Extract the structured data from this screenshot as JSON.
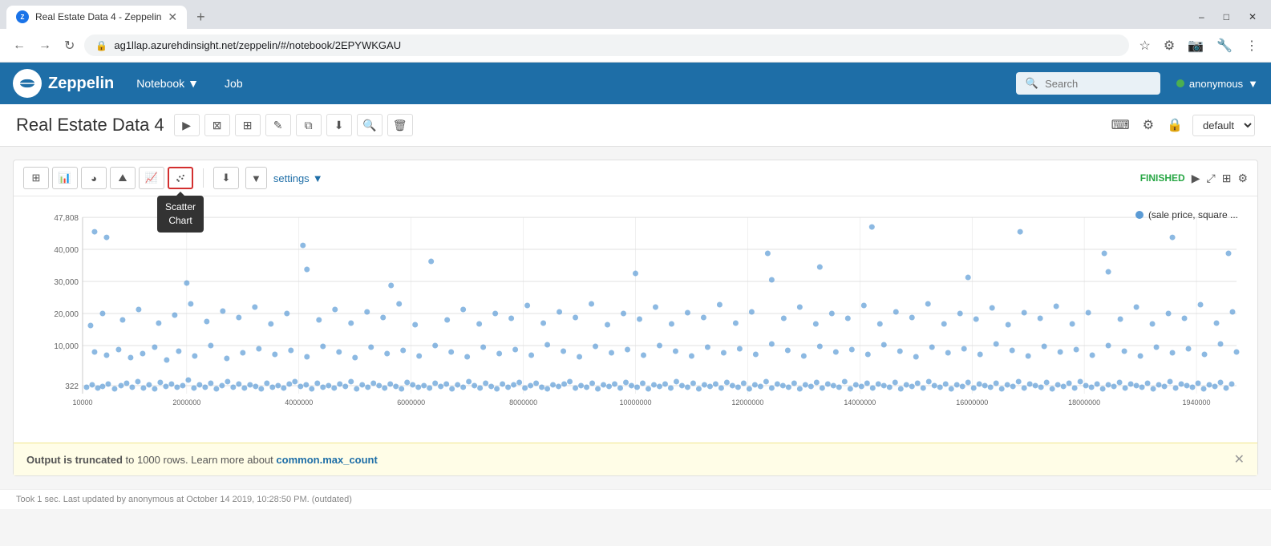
{
  "browser": {
    "tab_title": "Real Estate Data 4 - Zeppelin",
    "url": "ag1llap.azurehdinsight.net/zeppelin/#/notebook/2EPYWKGAU",
    "new_tab_icon": "+",
    "nav_back": "←",
    "nav_forward": "→",
    "nav_refresh": "↻"
  },
  "win_controls": {
    "minimize": "–",
    "maximize": "□",
    "close": "✕"
  },
  "navbar": {
    "logo_text": "Zeppelin",
    "notebook_label": "Notebook",
    "job_label": "Job",
    "search_placeholder": "Search",
    "user_name": "anonymous"
  },
  "page": {
    "title": "Real Estate Data 4",
    "default_label": "default"
  },
  "cell": {
    "status": "FINISHED",
    "settings_label": "settings",
    "legend_label": "(sale price, square ...",
    "tooltip_line1": "Scatter",
    "tooltip_line2": "Chart"
  },
  "chart": {
    "y_labels": [
      "47,808",
      "40,000",
      "30,000",
      "20,000",
      "10,000",
      "322"
    ],
    "x_labels": [
      "10000",
      "2000000",
      "4000000",
      "6000000",
      "8000000",
      "10000000",
      "12000000",
      "14000000",
      "16000000",
      "18000000",
      "1940000"
    ]
  },
  "status_bar": {
    "text_before_link": "Output is truncated to 1000 rows. Learn more about ",
    "link_text": "common.max_count",
    "bold_text": "Output is truncated"
  },
  "footer": {
    "text": "Took 1 sec. Last updated by anonymous at October 14 2019, 10:28:50 PM. (outdated)"
  }
}
